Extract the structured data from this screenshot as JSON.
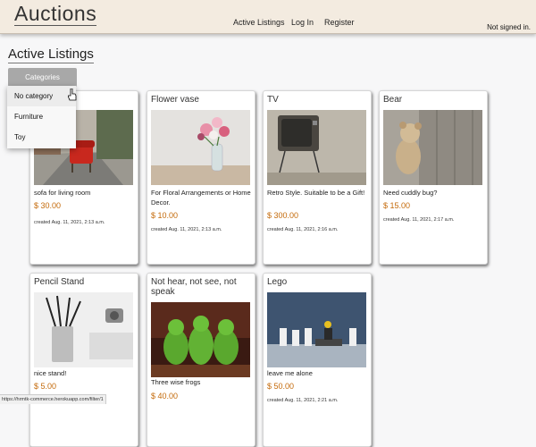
{
  "brand": "Auctions",
  "nav": {
    "active_listings": "Active Listings",
    "log_in": "Log In",
    "register": "Register"
  },
  "status": "Not signed in.",
  "page_title": "Active Listings",
  "categories_button": "Categories",
  "categories_menu": [
    "No category",
    "Furniture",
    "Toy"
  ],
  "listings": [
    {
      "title": "",
      "description": "sofa for living room",
      "price": "$ 30.00",
      "created": "created Aug. 11, 2021, 2:13 a.m."
    },
    {
      "title": "Flower vase",
      "description": "For Floral Arrangements or Home Decor.",
      "price": "$ 10.00",
      "created": "created Aug. 11, 2021, 2:13 a.m."
    },
    {
      "title": "TV",
      "description": "Retro Style. Suitable to be a Gift!",
      "price": "$ 300.00",
      "created": "created Aug. 11, 2021, 2:16 a.m."
    },
    {
      "title": "Bear",
      "description": "Need cuddly bug?",
      "price": "$ 15.00",
      "created": "created Aug. 11, 2021, 2:17 a.m."
    },
    {
      "title": "Pencil Stand",
      "description": "nice stand!",
      "price": "$ 5.00",
      "created": ""
    },
    {
      "title": "Not hear, not see, not speak",
      "description": "Three wise frogs",
      "price": "$ 40.00",
      "created": ""
    },
    {
      "title": "Lego",
      "description": "leave me alone",
      "price": "$ 50.00",
      "created": "created Aug. 11, 2021, 2:21 a.m."
    }
  ],
  "status_url": "https://hrmtk-commerce.herokuapp.com/filter/1"
}
